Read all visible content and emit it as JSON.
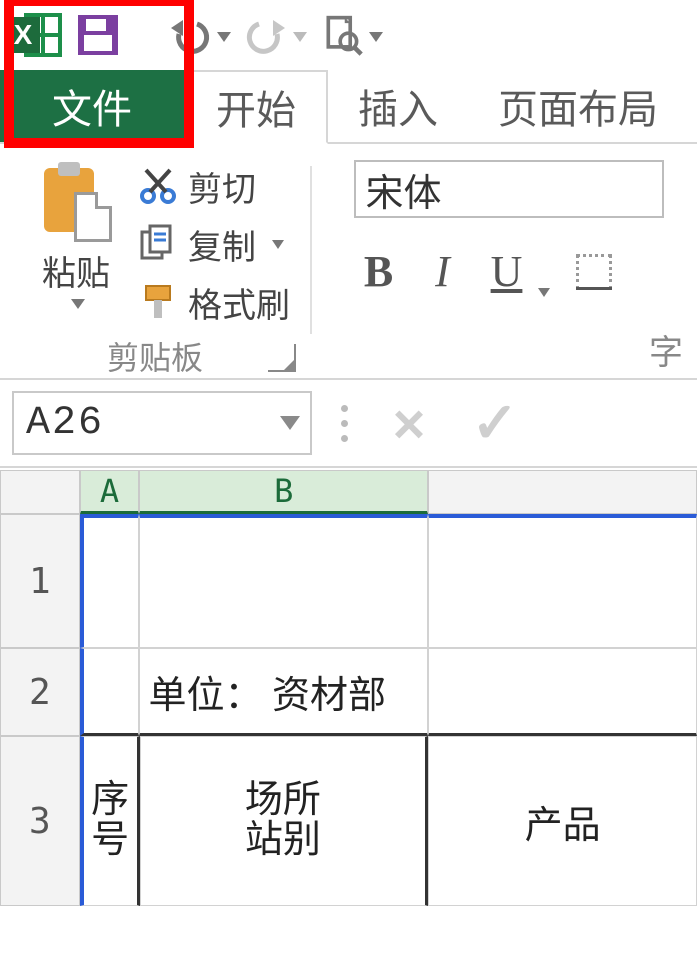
{
  "qat": {
    "excel_x": "X"
  },
  "tabs": {
    "file": "文件",
    "home": "开始",
    "insert": "插入",
    "layout": "页面布局"
  },
  "ribbon": {
    "paste_label": "粘贴",
    "cut": "剪切",
    "copy": "复制",
    "format_painter": "格式刷",
    "clipboard_group": "剪贴板",
    "font_group": "字",
    "font_name": "宋体",
    "bold": "B",
    "italic": "I",
    "underline": "U"
  },
  "editbar": {
    "namebox": "A26",
    "cancel": "×",
    "accept": "✓"
  },
  "grid": {
    "cols": {
      "A": "A",
      "B": "B"
    },
    "rows": {
      "r1": "1",
      "r2": "2",
      "r3": "3"
    },
    "cells": {
      "b2": "单位： 资材部",
      "a3_l1": "序",
      "a3_l2": "号",
      "b3_l1": "场所",
      "b3_l2": "站别",
      "c3": "产品"
    }
  }
}
